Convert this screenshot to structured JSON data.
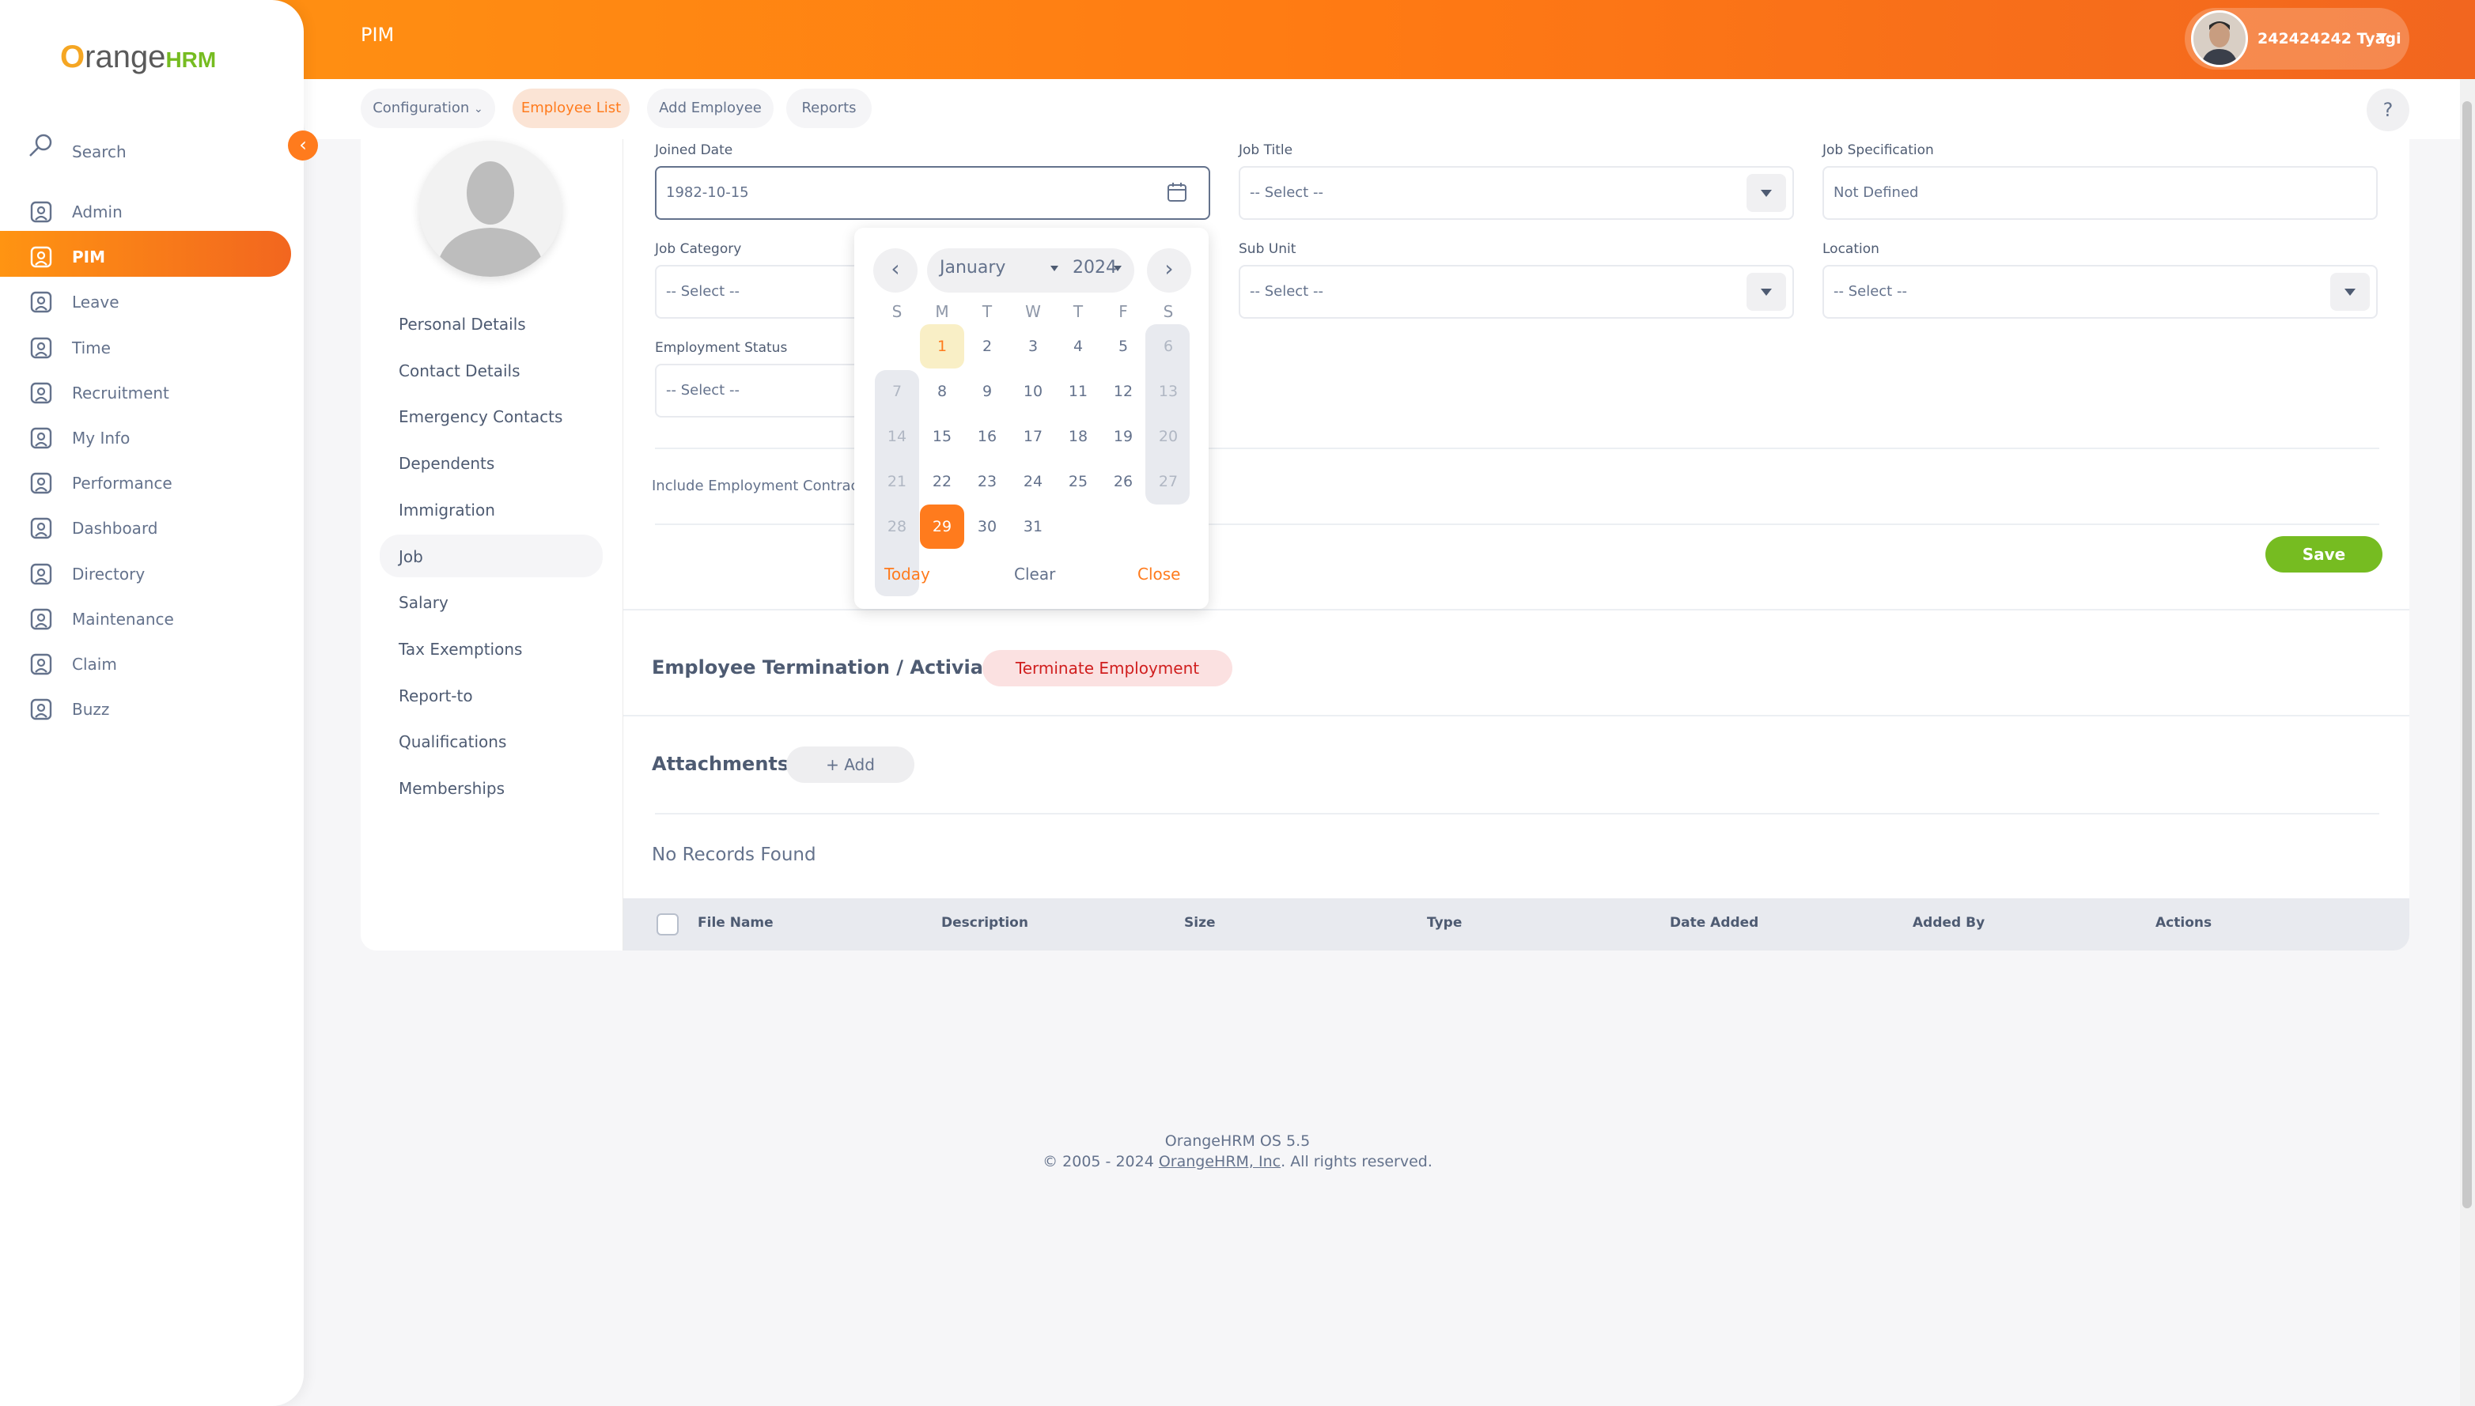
{
  "topbar": {
    "module_title": "PIM",
    "user_name": "242424242 Tyagi"
  },
  "subnav": {
    "configuration": "Configuration",
    "employee_list": "Employee List",
    "add_employee": "Add Employee",
    "reports": "Reports",
    "help": "?"
  },
  "sidebar": {
    "logo_o": "O",
    "logo_range": "range",
    "logo_hrm": "HRM",
    "search_label": "Search",
    "collapse": "‹",
    "items": [
      {
        "label": "Admin",
        "icon": "admin-icon"
      },
      {
        "label": "PIM",
        "icon": "pim-icon"
      },
      {
        "label": "Leave",
        "icon": "leave-icon"
      },
      {
        "label": "Time",
        "icon": "time-icon"
      },
      {
        "label": "Recruitment",
        "icon": "recruitment-icon"
      },
      {
        "label": "My Info",
        "icon": "my-info-icon"
      },
      {
        "label": "Performance",
        "icon": "performance-icon"
      },
      {
        "label": "Dashboard",
        "icon": "dashboard-icon"
      },
      {
        "label": "Directory",
        "icon": "directory-icon"
      },
      {
        "label": "Maintenance",
        "icon": "maintenance-icon"
      },
      {
        "label": "Claim",
        "icon": "claim-icon"
      },
      {
        "label": "Buzz",
        "icon": "buzz-icon"
      }
    ],
    "active_item": "PIM"
  },
  "employee_tabs": [
    "Personal Details",
    "Contact Details",
    "Emergency Contacts",
    "Dependents",
    "Immigration",
    "Job",
    "Salary",
    "Tax Exemptions",
    "Report-to",
    "Qualifications",
    "Memberships"
  ],
  "form": {
    "joined_date_label": "Joined Date",
    "joined_date_value": "1982-10-15",
    "job_title_label": "Job Title",
    "job_title_value": "-- Select --",
    "job_spec_label": "Job Specification",
    "job_spec_value": "Not Defined",
    "job_category_label": "Job Category",
    "job_category_value": "-- Select --",
    "sub_unit_label": "Sub Unit",
    "sub_unit_value": "-- Select --",
    "location_label": "Location",
    "location_value": "-- Select --",
    "employment_status_label": "Employment Status",
    "employment_status_value": "-- Select --",
    "include_contract_label": "Include Employment Contract",
    "save_label": "Save"
  },
  "datepicker": {
    "month": "January",
    "year": "2024",
    "weekdays": [
      "S",
      "M",
      "T",
      "W",
      "T",
      "F",
      "S"
    ],
    "weeks": [
      [
        "",
        "1",
        "2",
        "3",
        "4",
        "5",
        "6"
      ],
      [
        "7",
        "8",
        "9",
        "10",
        "11",
        "12",
        "13"
      ],
      [
        "14",
        "15",
        "16",
        "17",
        "18",
        "19",
        "20"
      ],
      [
        "21",
        "22",
        "23",
        "24",
        "25",
        "26",
        "27"
      ],
      [
        "28",
        "29",
        "30",
        "31",
        "",
        "",
        ""
      ]
    ],
    "today_day": "1",
    "selected_day": "29",
    "today_label": "Today",
    "clear_label": "Clear",
    "close_label": "Close"
  },
  "termination": {
    "title": "Employee Termination / Activiation",
    "button": "Terminate Employment"
  },
  "attachments": {
    "title": "Attachments",
    "add_label": "+ Add",
    "empty_text": "No Records Found",
    "columns": [
      "File Name",
      "Description",
      "Size",
      "Type",
      "Date Added",
      "Added By",
      "Actions"
    ]
  },
  "footer": {
    "version": "OrangeHRM OS 5.5",
    "copyright_prefix": "© 2005 - 2024 ",
    "company_link": "OrangeHRM, Inc",
    "copyright_suffix": ". All rights reserved."
  },
  "colors": {
    "brand_orange": "#ff7b1d",
    "brand_green": "#76bc21",
    "danger": "#d01e1e"
  }
}
